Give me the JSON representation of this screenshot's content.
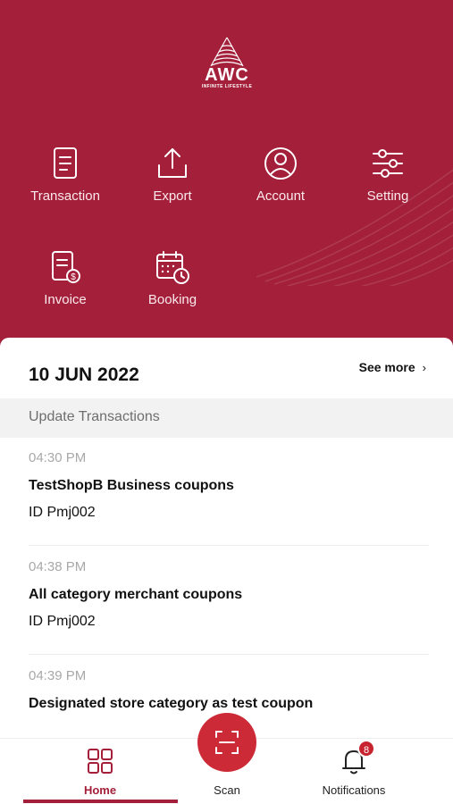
{
  "brand": {
    "logo_title": "AWC",
    "logo_subtitle": "INFINITE LIFESTYLE",
    "logo_text_color": "#ffffff",
    "primary_color": "#a31f3a"
  },
  "menu": [
    {
      "label": "Transaction",
      "icon": "document-icon"
    },
    {
      "label": "Export",
      "icon": "upload-icon"
    },
    {
      "label": "Account",
      "icon": "user-circle-icon"
    },
    {
      "label": "Setting",
      "icon": "sliders-icon"
    },
    {
      "label": "Invoice",
      "icon": "invoice-dollar-icon"
    },
    {
      "label": "Booking",
      "icon": "calendar-clock-icon"
    }
  ],
  "feed": {
    "date": "10 JUN 2022",
    "see_more": "See more",
    "see_more_icon": "chevron-right-icon",
    "section_title": "Update Transactions",
    "transactions": [
      {
        "time": "04:30 PM",
        "name": "TestShopB Business coupons",
        "id": "ID Pmj002"
      },
      {
        "time": "04:38 PM",
        "name": "All category merchant coupons",
        "id": "ID Pmj002"
      },
      {
        "time": "04:39 PM",
        "name": "Designated store category as test coupon"
      }
    ]
  },
  "tabbar": {
    "home": {
      "label": "Home",
      "icon": "grid-icon",
      "active": true
    },
    "scan": {
      "label": "Scan",
      "icon": "scan-icon"
    },
    "notifications": {
      "label": "Notifications",
      "icon": "bell-icon",
      "badge": "8"
    }
  }
}
